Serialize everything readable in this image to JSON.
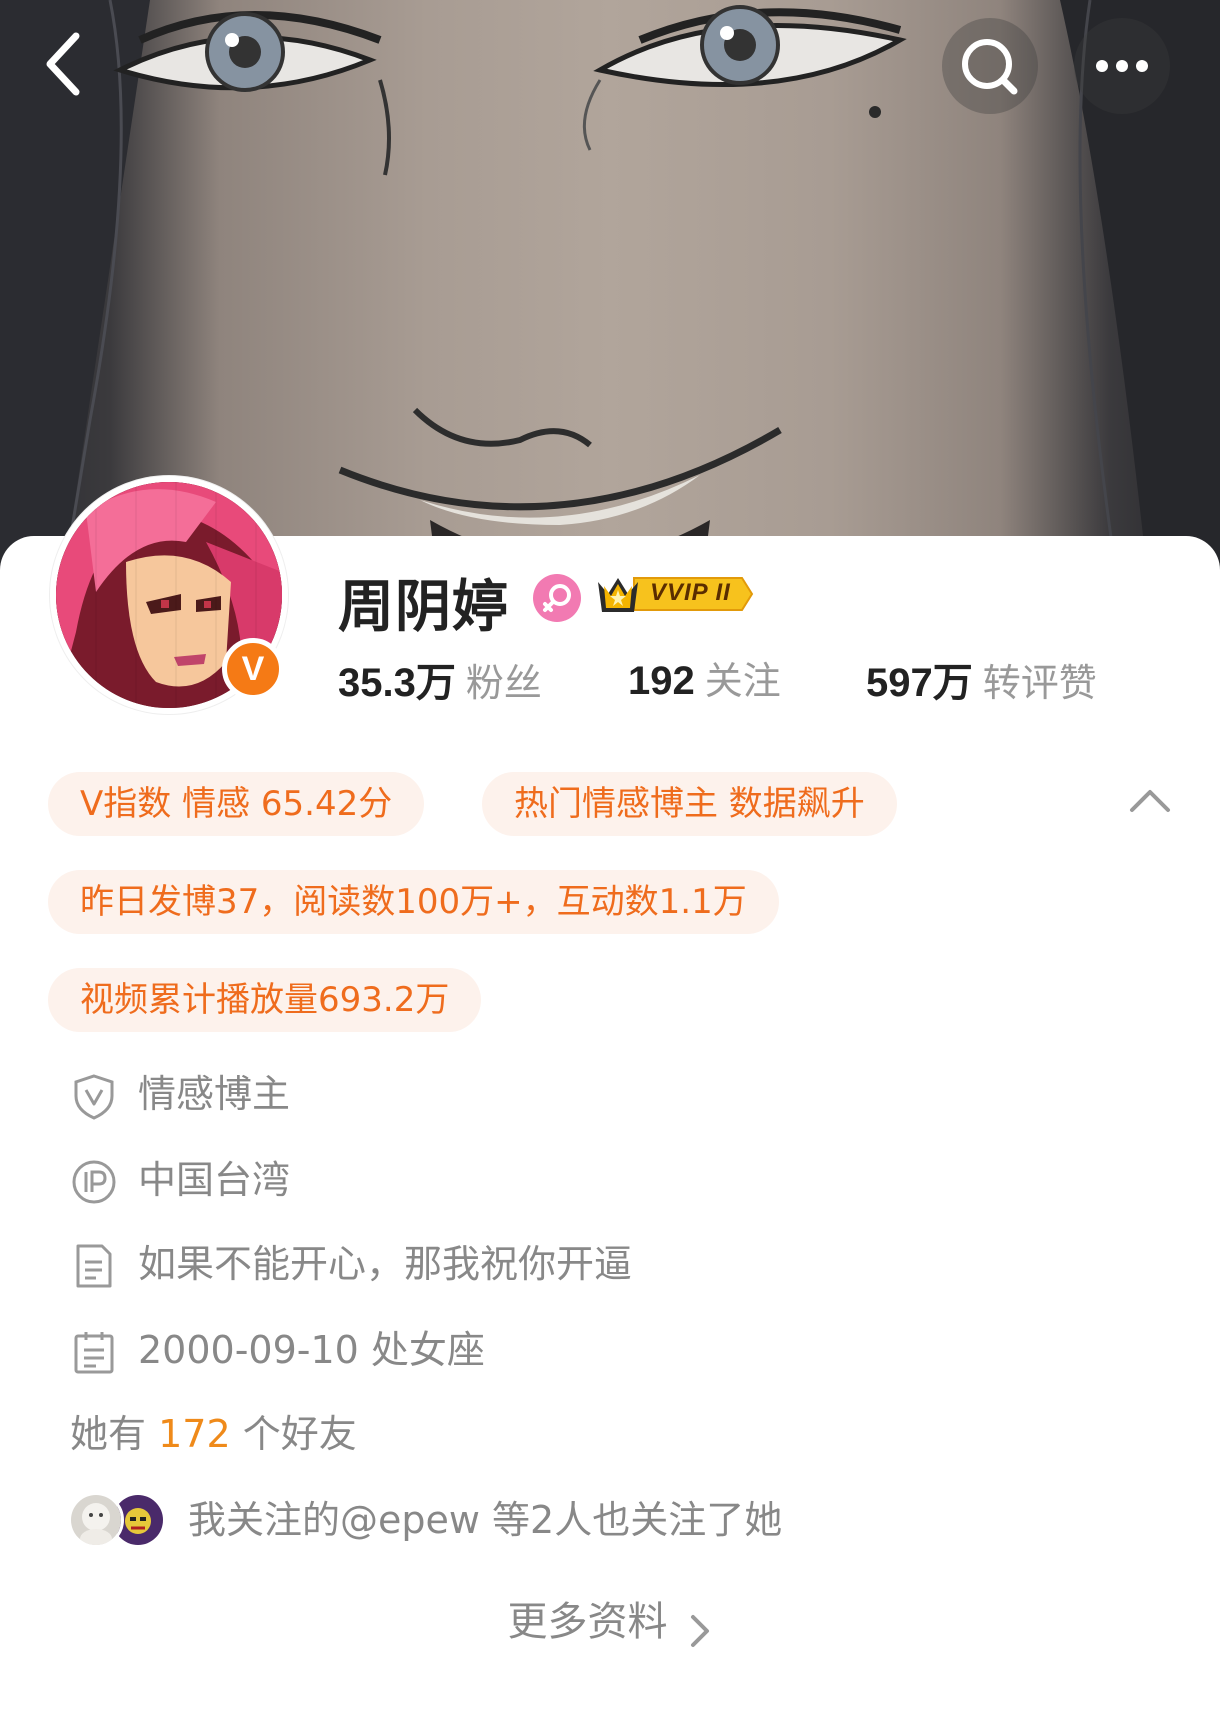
{
  "header": {
    "back_icon": "chevron-left-icon",
    "search_icon": "search-icon",
    "more_icon": "more-horizontal-icon"
  },
  "profile": {
    "name": "周阴婷",
    "gender_icon": "female-icon",
    "vip_label": "VVIP II",
    "verified_badge": "V",
    "stats": [
      {
        "value": "35.3万",
        "label": "粉丝"
      },
      {
        "value": "192",
        "label": "关注"
      },
      {
        "value": "597万",
        "label": "转评赞"
      }
    ]
  },
  "tags": {
    "v_index": "V指数 情感 65.42分",
    "hot": "热门情感博主 数据飙升",
    "yesterday": "昨日发博37，阅读数100万+，互动数1.1万",
    "video": "视频累计播放量693.2万"
  },
  "info": {
    "category": "情感博主",
    "ip": "中国台湾",
    "bio": "如果不能开心，那我祝你开逼",
    "birthday": "2000-09-10 处女座"
  },
  "friends": {
    "prefix": "她有",
    "count": "172",
    "suffix": "个好友"
  },
  "mutual": {
    "text": "我关注的@epew 等2人也关注了她"
  },
  "more_info_label": "更多资料",
  "colors": {
    "accent_orange": "#ef6c1d",
    "pill_bg": "#fdf2ec",
    "muted_text": "#888888",
    "gender_pink": "#f27ab2"
  }
}
